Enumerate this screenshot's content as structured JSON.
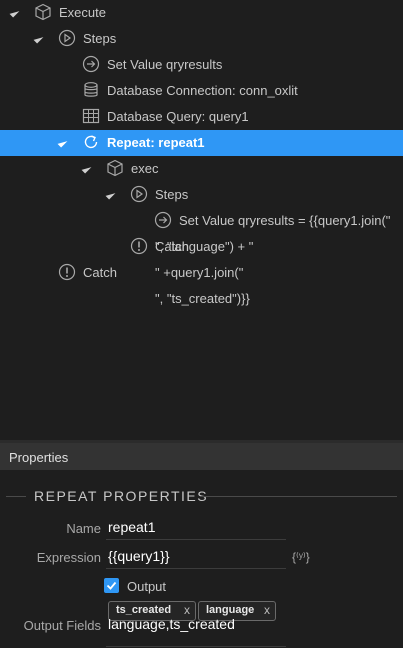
{
  "tree": {
    "execute": "Execute",
    "steps": "Steps",
    "set_value": "Set Value qryresults",
    "db_connection": "Database Connection: conn_oxlit",
    "db_query": "Database Query: query1",
    "repeat": "Repeat: repeat1",
    "exec": "exec",
    "inner_steps": "Steps",
    "inner_set_value": "Set Value qryresults = {{query1.join(\"",
    "inner_catch": "Catch",
    "overflow_line1": "\", \"language\") + \"",
    "overflow_line2": "\" +query1.join(\"",
    "overflow_line3": "\", \"ts_created\")}}",
    "catch": "Catch"
  },
  "properties": {
    "header": "Properties",
    "section_title": "REPEAT PROPERTIES",
    "name_label": "Name",
    "name_value": "repeat1",
    "expression_label": "Expression",
    "expression_value": "{{query1}}",
    "dynamic_icon": "{⁽ʸ⁾}",
    "output_label": "Output",
    "output_checked": true,
    "output_fields_label": "Output Fields",
    "output_fields_value": "language,ts_created",
    "chips": [
      {
        "label": "ts_created",
        "remove": "x"
      },
      {
        "label": "language",
        "remove": "x"
      }
    ]
  },
  "colors": {
    "selection": "#2f97f5",
    "background": "#1e1e1e",
    "header": "#333333"
  }
}
